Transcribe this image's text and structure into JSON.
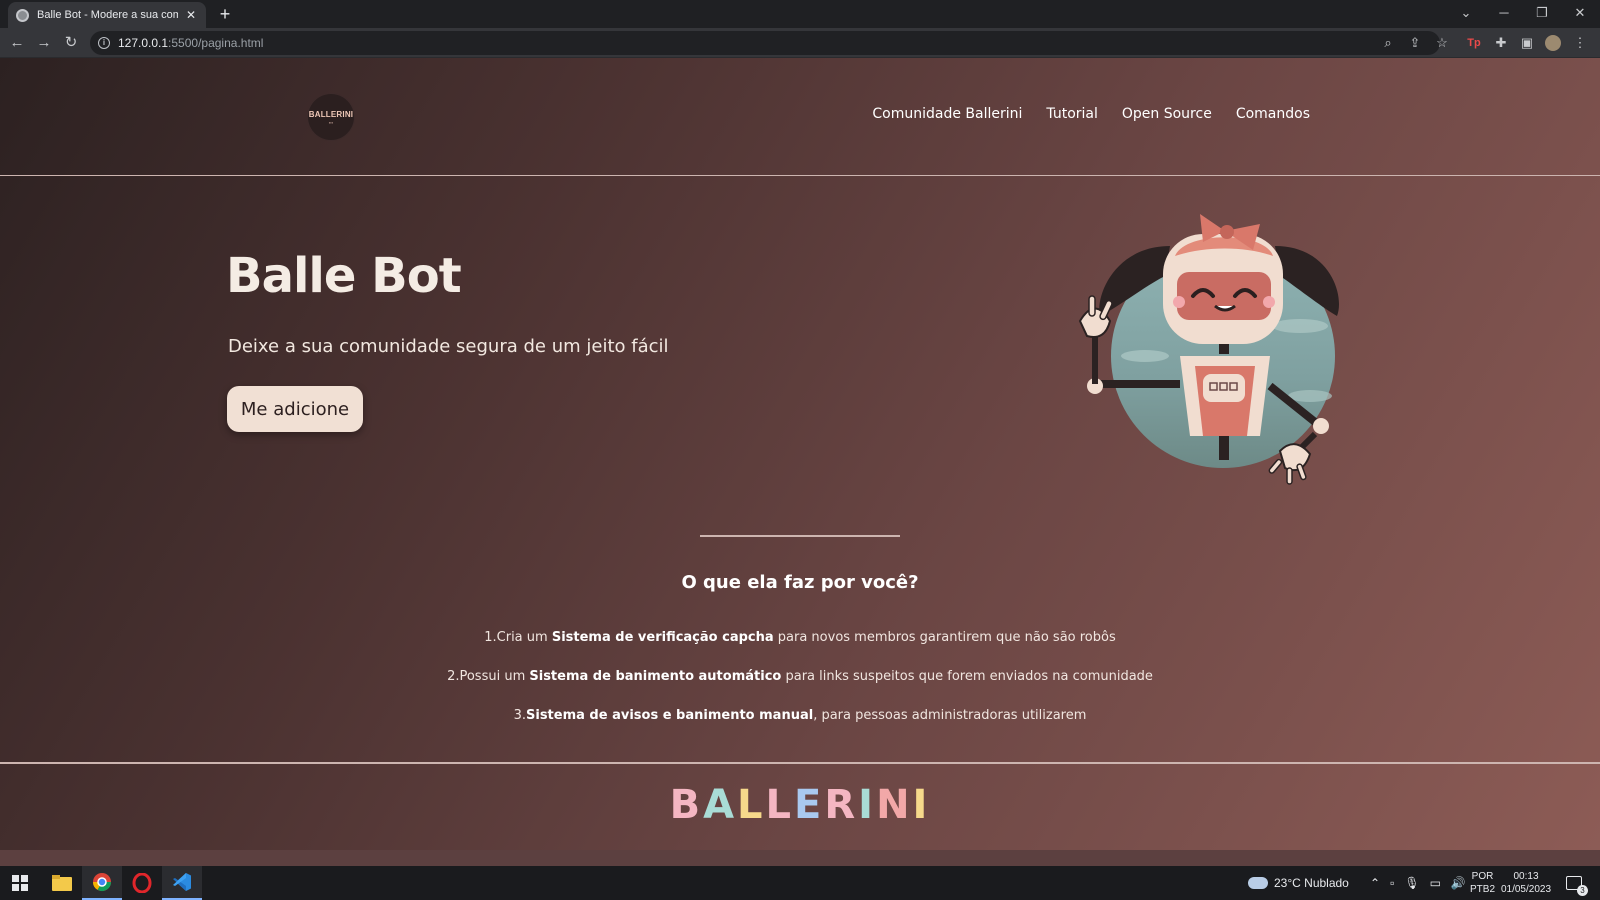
{
  "browser": {
    "tab_title": "Balle Bot - Modere a sua comunidade",
    "tab_close": "✕",
    "new_tab": "+",
    "url_host": "127.0.0.1",
    "url_path": ":5500/pagina.html"
  },
  "site": {
    "logo_text": "BALLERINI",
    "nav": [
      "Comunidade Ballerini",
      "Tutorial",
      "Open Source",
      "Comandos"
    ],
    "hero_title": "Balle Bot",
    "hero_subtitle": "Deixe a sua comunidade segura de um jeito fácil",
    "cta_label": "Me adicione",
    "section_title": "O que ela faz por você?",
    "features": [
      {
        "prefix": "1.Cria um ",
        "bold": "Sistema de verificação capcha",
        "suffix": " para novos membros garantirem que não são robôs"
      },
      {
        "prefix": "2.Possui um ",
        "bold": "Sistema de banimento automático",
        "suffix": " para links suspeitos que forem enviados na comunidade"
      },
      {
        "prefix": "3.",
        "bold": "Sistema de avisos e banimento manual",
        "suffix": ", para pessoas administradoras utilizarem"
      }
    ],
    "footer_letters": [
      "B",
      "A",
      "L",
      "L",
      "E",
      "R",
      "I",
      "N",
      "I"
    ],
    "footer_colors": [
      "#f4b6c2",
      "#a9dcd6",
      "#f6d98b",
      "#f4b6c2",
      "#a9c9f0",
      "#f4b6c2",
      "#a9dcd6",
      "#f2a8a8",
      "#f6d98b"
    ]
  },
  "taskbar": {
    "weather": "23°C  Nublado",
    "lang_1": "POR",
    "lang_2": "PTB2",
    "time": "00:13",
    "date": "01/05/2023",
    "notifications": "3"
  }
}
